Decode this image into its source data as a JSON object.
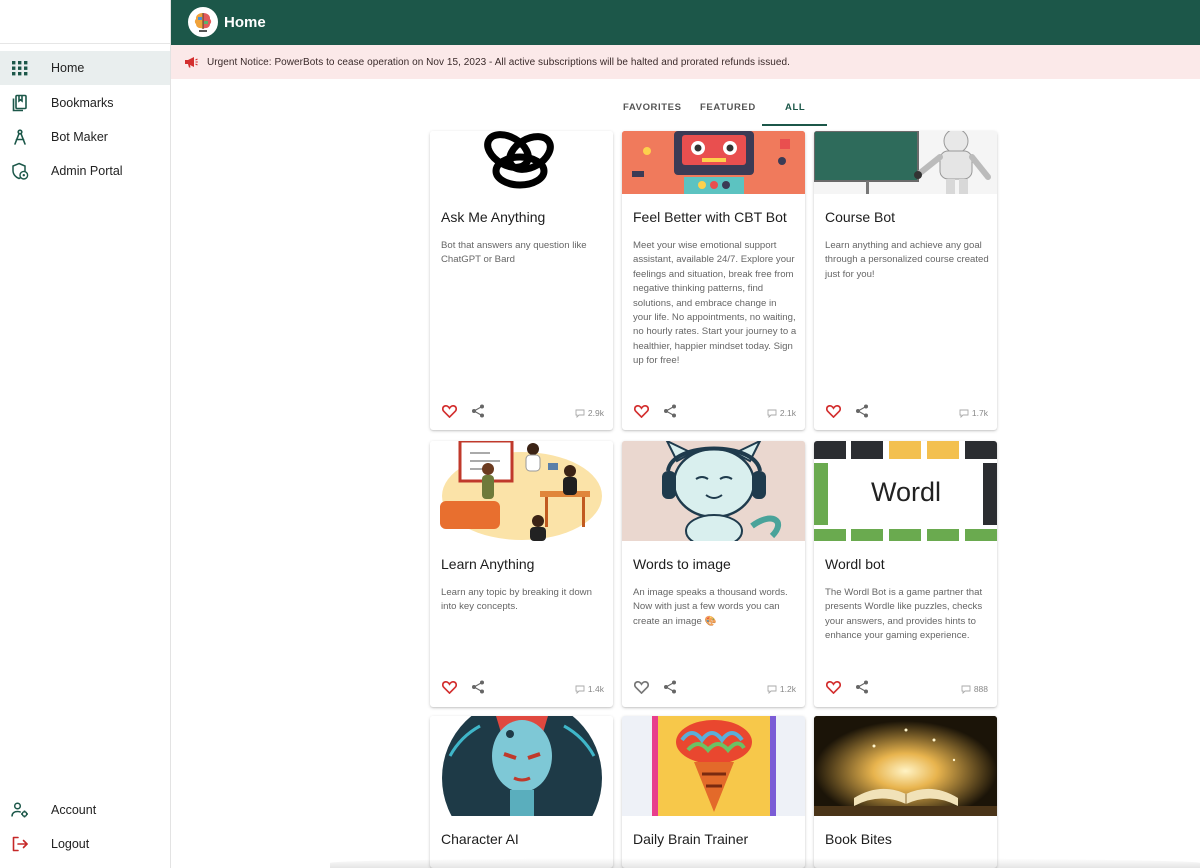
{
  "app": {
    "title": "Home"
  },
  "notice": {
    "text": "Urgent Notice: PowerBots to cease operation on Nov 15, 2023 - All active subscriptions will be halted and prorated refunds issued."
  },
  "sidebar": {
    "items": [
      {
        "label": "Home",
        "icon": "grid-icon",
        "active": true
      },
      {
        "label": "Bookmarks",
        "icon": "bookmarks-icon"
      },
      {
        "label": "Bot Maker",
        "icon": "compass-icon"
      },
      {
        "label": "Admin Portal",
        "icon": "admin-icon"
      }
    ],
    "bottom": [
      {
        "label": "Account",
        "icon": "account-icon"
      },
      {
        "label": "Logout",
        "icon": "logout-icon"
      }
    ]
  },
  "tabs": [
    {
      "label": "FAVORITES"
    },
    {
      "label": "FEATURED"
    },
    {
      "label": "ALL",
      "active": true
    }
  ],
  "cards": [
    {
      "title": "Ask Me Anything",
      "desc": "Bot that answers any question like ChatGPT or Bard",
      "count": "2.9k",
      "liked": true
    },
    {
      "title": "Feel Better with CBT Bot",
      "desc": "Meet your wise emotional support assistant, available 24/7. Explore your feelings and situation, break free from negative thinking patterns, find solutions, and embrace change in your life. No appointments, no waiting, no hourly rates. Start your journey to a healthier, happier mindset today. Sign up for free!",
      "count": "2.1k",
      "liked": true
    },
    {
      "title": "Course Bot",
      "desc": "Learn anything and achieve any goal through a personalized course created just for you!",
      "count": "1.7k",
      "liked": true
    },
    {
      "title": "Learn Anything",
      "desc": "Learn any topic by breaking it down into key concepts.",
      "count": "1.4k",
      "liked": true
    },
    {
      "title": "Words to image",
      "desc": "An image speaks a thousand words. Now with just a few words you can create an image 🎨",
      "count": "1.2k",
      "liked": false
    },
    {
      "title": "Wordl bot",
      "desc": "The Wordl Bot is a game partner that presents Wordle like puzzles, checks your answers, and provides hints to enhance your gaming experience.",
      "count": "888",
      "liked": true
    },
    {
      "title": "Character AI"
    },
    {
      "title": "Daily Brain Trainer"
    },
    {
      "title": "Book Bites"
    }
  ],
  "images": {
    "wordl_text": "Wordl"
  },
  "colors": {
    "brand": "#1c5749",
    "notice_bg": "#fbe9e9",
    "heart": "#d32f2f"
  }
}
